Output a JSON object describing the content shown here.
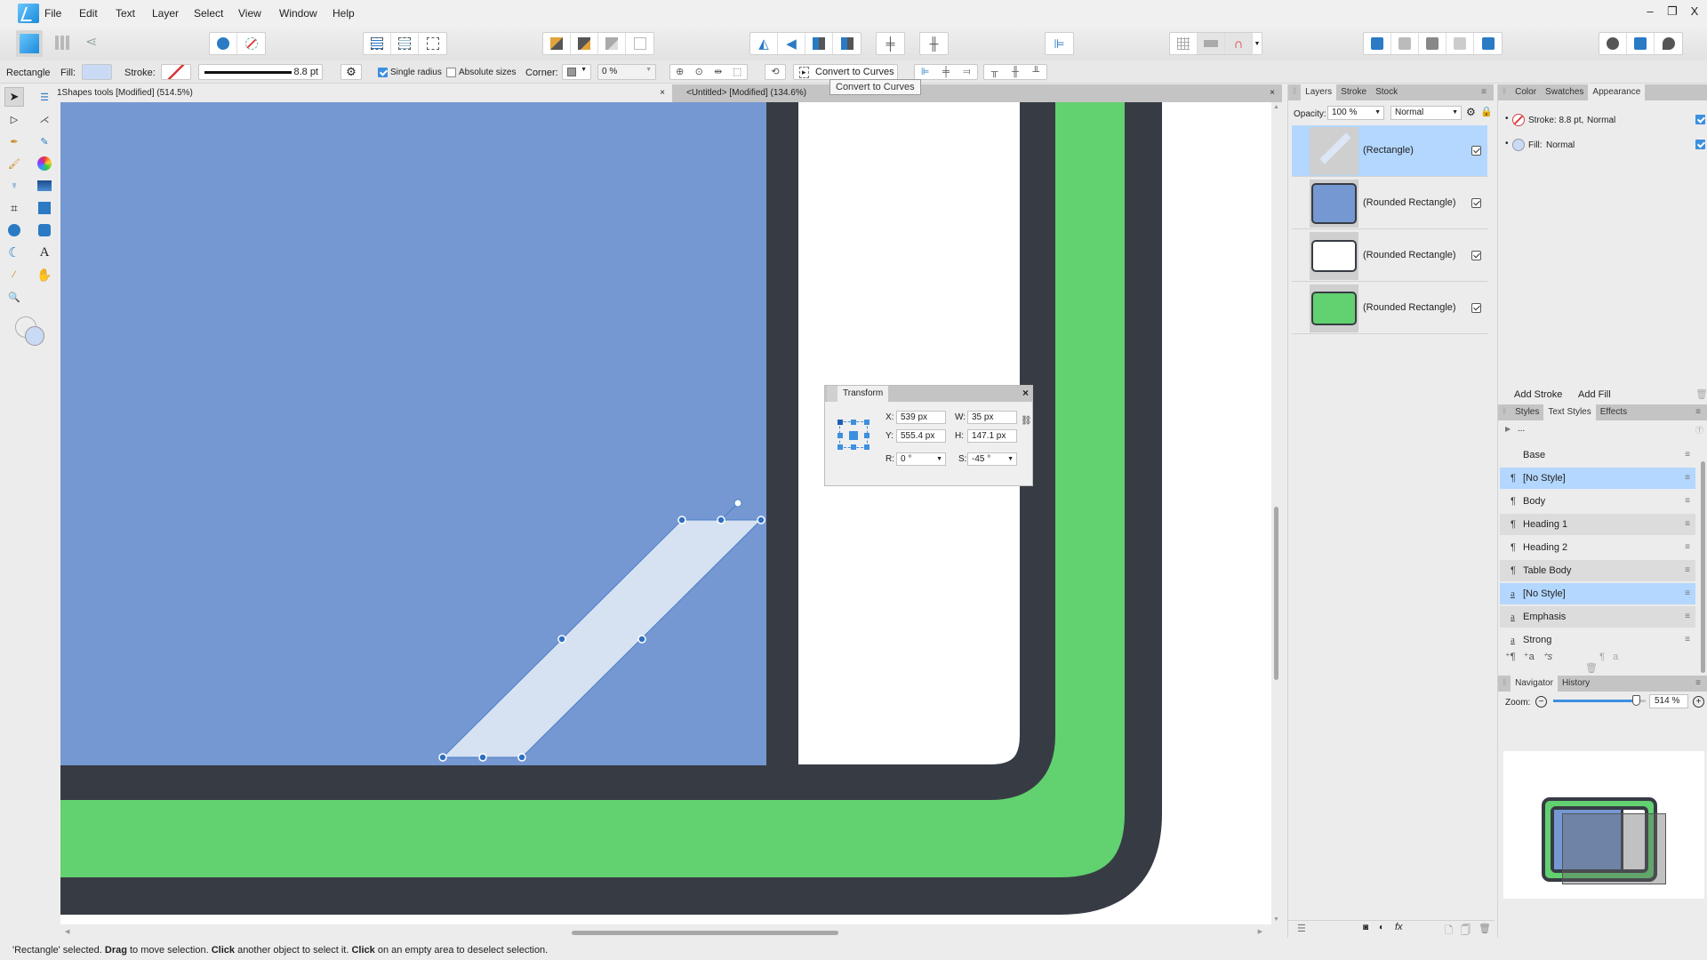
{
  "menu": {
    "items": [
      "File",
      "Edit",
      "Text",
      "Layer",
      "Select",
      "View",
      "Window",
      "Help"
    ],
    "window_controls": {
      "minimize": "–",
      "restore": "❐",
      "close": "X"
    }
  },
  "context_bar": {
    "tool_name": "Rectangle",
    "fill_label": "Fill:",
    "fill_color": "#c9daf5",
    "stroke_label": "Stroke:",
    "stroke_width": "8.8 pt",
    "single_radius_label": "Single radius",
    "single_radius_checked": true,
    "absolute_sizes_label": "Absolute sizes",
    "absolute_sizes_checked": false,
    "corner_label": "Corner:",
    "corner_value": "0 %",
    "convert_to_curves_label": "Convert to Curves",
    "tooltip": "Convert to Curves"
  },
  "document_tabs": [
    {
      "title": "1Shapes tools [Modified] (514.5%)",
      "active": true,
      "close": "×"
    },
    {
      "title": "<Untitled> [Modified] (134.6%)",
      "active": false,
      "close": "×"
    }
  ],
  "colors": {
    "blue_fill": "#7598d3",
    "dark_stroke": "#373c44",
    "green_fill": "#62d170",
    "white_fill": "#ffffff",
    "selected_fill": "#d6e1f2",
    "accent": "#3d8fdf",
    "selection_highlight": "#b3d7ff"
  },
  "layers_panel": {
    "tabs": [
      "Layers",
      "Stroke",
      "Stock"
    ],
    "opacity_label": "Opacity:",
    "opacity_value": "100 %",
    "blend_mode": "Normal",
    "layers": [
      {
        "name": "(Rectangle)",
        "selected": true,
        "visible": true,
        "thumb": "rectangle"
      },
      {
        "name": "(Rounded Rectangle)",
        "selected": false,
        "visible": true,
        "thumb": "blue"
      },
      {
        "name": "(Rounded Rectangle)",
        "selected": false,
        "visible": true,
        "thumb": "white"
      },
      {
        "name": "(Rounded Rectangle)",
        "selected": false,
        "visible": true,
        "thumb": "green"
      }
    ]
  },
  "appearance_panel": {
    "tabs": [
      "Color",
      "Swatches",
      "Appearance"
    ],
    "active_tab": "Appearance",
    "stroke_entry": "Stroke: 8.8 pt,",
    "stroke_mode": "Normal",
    "fill_entry": "Fill:",
    "fill_mode": "Normal",
    "add_stroke": "Add Stroke",
    "add_fill": "Add Fill"
  },
  "text_styles_panel": {
    "tabs": [
      "Styles",
      "Text Styles",
      "Effects"
    ],
    "active_tab": "Text Styles",
    "group_label": "...",
    "styles": [
      {
        "name": "Base",
        "icon": "",
        "selected": false,
        "alt": false
      },
      {
        "name": "[No Style]",
        "icon": "¶",
        "selected": true,
        "alt": false
      },
      {
        "name": "Body",
        "icon": "¶",
        "selected": false,
        "alt": false
      },
      {
        "name": "Heading 1",
        "icon": "¶",
        "selected": false,
        "alt": true
      },
      {
        "name": "Heading 2",
        "icon": "¶",
        "selected": false,
        "alt": false
      },
      {
        "name": "Table Body",
        "icon": "¶",
        "selected": false,
        "alt": true
      },
      {
        "name": "[No Style]",
        "icon": "a",
        "selected": true,
        "alt": false
      },
      {
        "name": "Emphasis",
        "icon": "a",
        "selected": false,
        "alt": true
      },
      {
        "name": "Strong",
        "icon": "a",
        "selected": false,
        "alt": false
      }
    ]
  },
  "navigator_panel": {
    "tabs": [
      "Navigator",
      "History"
    ],
    "zoom_label": "Zoom:",
    "zoom_value": "514 %",
    "zoom_slider_fraction": 0.9
  },
  "transform_panel": {
    "title": "Transform",
    "x_label": "X:",
    "x_value": "539 px",
    "y_label": "Y:",
    "y_value": "555.4 px",
    "w_label": "W:",
    "w_value": "35 px",
    "h_label": "H:",
    "h_value": "147.1 px",
    "r_label": "R:",
    "r_value": "0 °",
    "s_label": "S:",
    "s_value": "-45 °"
  },
  "status_bar": {
    "parts": [
      {
        "text": "'Rectangle' selected. ",
        "bold": false
      },
      {
        "text": "Drag",
        "bold": true
      },
      {
        "text": " to move selection. ",
        "bold": false
      },
      {
        "text": "Click",
        "bold": true
      },
      {
        "text": " another object to select it. ",
        "bold": false
      },
      {
        "text": "Click",
        "bold": true
      },
      {
        "text": " on an empty area to deselect selection.",
        "bold": false
      }
    ]
  }
}
